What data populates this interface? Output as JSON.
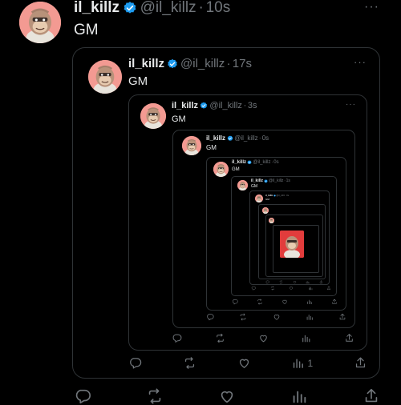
{
  "tweets": [
    {
      "name": "il_killz",
      "handle": "@il_killz",
      "separator": "·",
      "time": "10s",
      "text": "GM"
    },
    {
      "name": "il_killz",
      "handle": "@il_killz",
      "separator": "·",
      "time": "17s",
      "text": "GM",
      "views": "1"
    },
    {
      "name": "il_killz",
      "handle": "@il_killz",
      "separator": "·",
      "time": "3s",
      "text": "GM"
    },
    {
      "name": "il_killz",
      "handle": "@il_killz",
      "separator": "·",
      "time": "0s",
      "text": "GM"
    },
    {
      "name": "il_killz",
      "handle": "@il_killz",
      "separator": "·",
      "time": "0s",
      "text": "GM"
    },
    {
      "name": "il_killz",
      "handle": "@il_killz",
      "separator": "·",
      "time": "1s",
      "text": "GM"
    },
    {
      "name": "il_killz",
      "handle": "@il_killz",
      "separator": "·",
      "time": "0s",
      "text": "GM"
    }
  ],
  "more_label": "···",
  "icons": {
    "verified": "verified-badge-icon",
    "reply": "reply-icon",
    "retweet": "retweet-icon",
    "like": "heart-icon",
    "views": "views-icon",
    "share": "share-icon",
    "avatar": "bored-ape-avatar"
  },
  "colors": {
    "background": "#000000",
    "verified": "#1d9bf0",
    "muted": "#71767b",
    "border": "#2f3336",
    "avatar_bg": "#f0a0a0"
  }
}
